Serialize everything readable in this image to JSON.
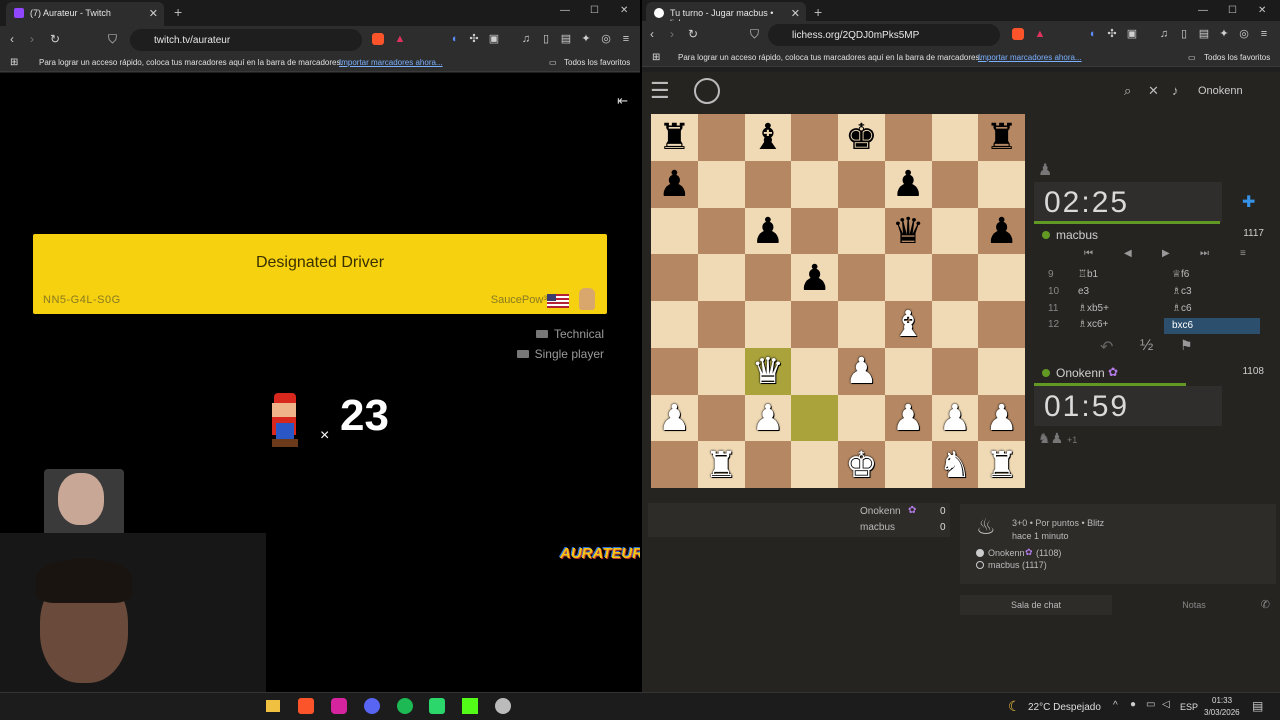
{
  "left": {
    "tab": {
      "title": "(7) Aurateur - Twitch"
    },
    "url": "twitch.tv/aurateur",
    "bookmarks": {
      "prompt": "Para lograr un acceso rápido, coloca tus marcadores aquí en la barra de marcadores.",
      "import": "Importar marcadores ahora...",
      "all": "Todos los favoritos"
    },
    "stream": {
      "level_title": "Designated Driver",
      "level_code": "NN5-G4L-S0G",
      "maker": "SaucePow³",
      "tags": [
        "Technical",
        "Single player"
      ],
      "lives": "23",
      "lives_x": "×",
      "brand": "AURATEUR"
    }
  },
  "right": {
    "tab": {
      "title": "Tu turno - Jugar macbus • liches"
    },
    "url": "lichess.org/2QDJ0mPks5MP",
    "bookmarks": {
      "prompt": "Para lograr un acceso rápido, coloca tus marcadores aquí en la barra de marcadores.",
      "import": "Importar marcadores ahora...",
      "all": "Todos los favoritos"
    },
    "user": "Onokenn",
    "top_clock": "02:25",
    "top_player": {
      "name": "macbus",
      "rating": "1117"
    },
    "bottom_clock": "01:59",
    "bottom_player": {
      "name": "Onokenn",
      "rating": "1108"
    },
    "material": "+1",
    "moves": [
      {
        "n": "9",
        "w": "♖b1",
        "b": "♕f6"
      },
      {
        "n": "10",
        "w": "e3",
        "b": "♗c3"
      },
      {
        "n": "11",
        "w": "♗xb5+",
        "b": "♗c6"
      },
      {
        "n": "12",
        "w": "♗xc6+",
        "b": "bxc6"
      }
    ],
    "draw_symbol": "½",
    "crosstable": [
      {
        "name": "Onokenn",
        "score": "0"
      },
      {
        "name": "macbus",
        "score": "0"
      }
    ],
    "game_info": {
      "mode": "3+0 • Por puntos • Blitz",
      "when": "hace 1 minuto",
      "white": "Onokenn",
      "white_rating": "(1108)",
      "black": "macbus (1117)"
    },
    "chat_tab": "Sala de chat",
    "notes_tab": "Notas"
  },
  "taskbar": {
    "weather": "22°C Despejado",
    "lang": "ESP",
    "time": "01:33",
    "date": "3/03/2026"
  }
}
